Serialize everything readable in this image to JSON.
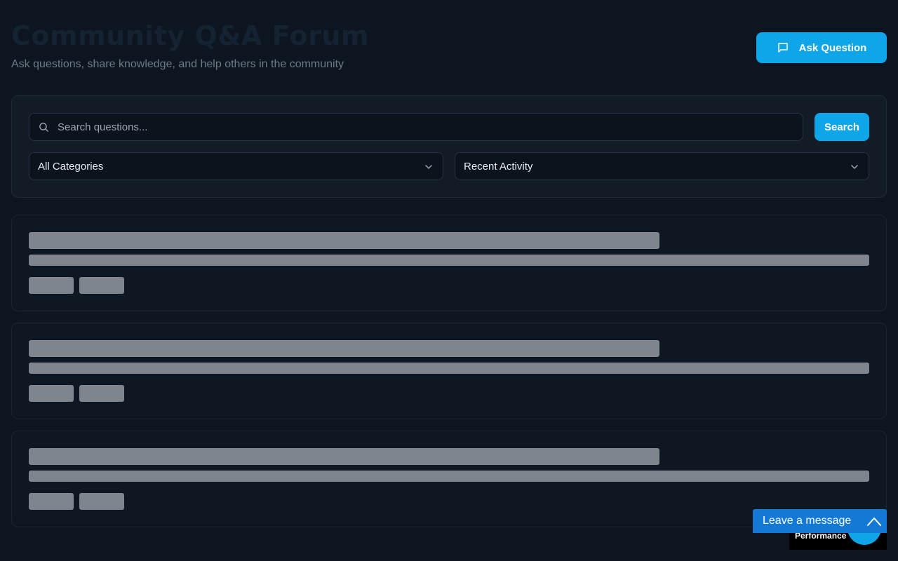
{
  "header": {
    "title": "Community Q&A Forum",
    "subtitle": "Ask questions, share knowledge, and help others in the community",
    "ask_button_label": "Ask Question"
  },
  "search": {
    "placeholder": "Search questions...",
    "value": "",
    "button_label": "Search"
  },
  "filters": {
    "category_selected": "All Categories",
    "sort_selected": "Recent Activity"
  },
  "widgets": {
    "performance_label": "Performance",
    "chat_label": "Leave a message"
  },
  "colors": {
    "accent": "#0ea5e9",
    "background": "#0d1620",
    "chat": "#1479d4",
    "skeleton": "#7f858c"
  },
  "icons": [
    "message-square-icon",
    "search-icon",
    "chevron-down-icon",
    "chevron-up-icon"
  ]
}
